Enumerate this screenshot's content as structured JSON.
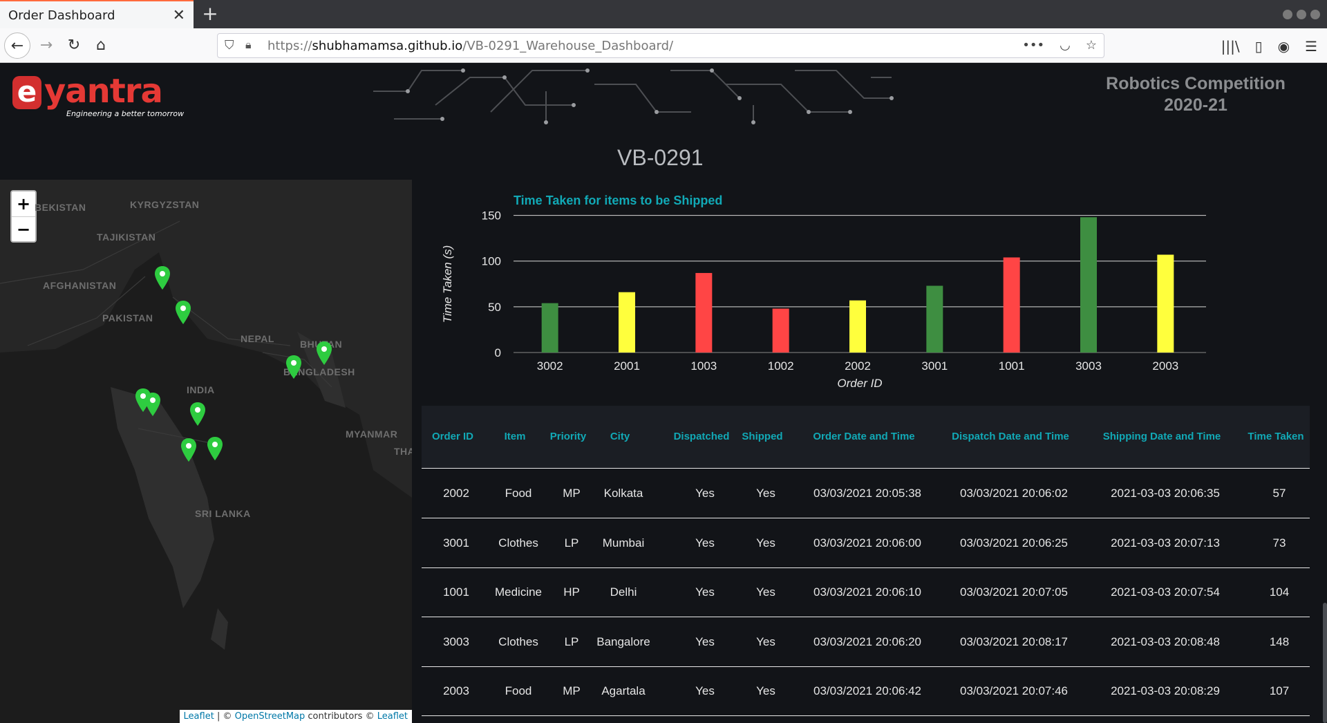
{
  "browser": {
    "tab_title": "Order Dashboard",
    "url_prefix": "https://",
    "url_domain": "shubhamamsa.github.io",
    "url_path": "/VB-0291_Warehouse_Dashboard/"
  },
  "header": {
    "logo_text": "yantra",
    "logo_letter": "e",
    "logo_tagline": "Engineering a better tomorrow",
    "competition_line1": "Robotics Competition",
    "competition_line2": "2020-21",
    "team_id": "VB-0291"
  },
  "map": {
    "zoom_in": "+",
    "zoom_out": "−",
    "labels": [
      "BEKISTAN",
      "KYRGYZSTAN",
      "TAJIKISTAN",
      "AFGHANISTAN",
      "PAKISTAN",
      "NEPAL",
      "BHUTAN",
      "BANGLADESH",
      "INDIA",
      "MYANMAR",
      "SRI LANKA",
      "THA"
    ],
    "marker_color": "#2ecc40",
    "attribution": {
      "leaflet": "Leaflet",
      "osm": "OpenStreetMap",
      "contributors": "contributors ©",
      "leaflet2": "Leaflet"
    }
  },
  "chart_data": {
    "type": "bar",
    "title": "Time Taken for items to be Shipped",
    "xlabel": "Order ID",
    "ylabel": "Time Taken (s)",
    "categories": [
      "3002",
      "2001",
      "1003",
      "1002",
      "2002",
      "3001",
      "1001",
      "3003",
      "2003"
    ],
    "values": [
      54,
      66,
      87,
      48,
      57,
      73,
      104,
      148,
      107
    ],
    "colors": [
      "#3e8e41",
      "#ffff3d",
      "#ff4545",
      "#ff4545",
      "#ffff3d",
      "#3e8e41",
      "#ff4545",
      "#3e8e41",
      "#ffff3d"
    ],
    "yticks": [
      0,
      50,
      100,
      150
    ],
    "ylim": [
      0,
      155
    ],
    "grid": true
  },
  "table": {
    "headers": [
      "Order ID",
      "Item",
      "Priority",
      "City",
      "Dispatched",
      "Shipped",
      "Order Date and Time",
      "Dispatch Date and Time",
      "Shipping Date and Time",
      "Time Taken"
    ],
    "rows": [
      [
        "2002",
        "Food",
        "MP",
        "Kolkata",
        "Yes",
        "Yes",
        "03/03/2021 20:05:38",
        "03/03/2021 20:06:02",
        "2021-03-03 20:06:35",
        "57"
      ],
      [
        "3001",
        "Clothes",
        "LP",
        "Mumbai",
        "Yes",
        "Yes",
        "03/03/2021 20:06:00",
        "03/03/2021 20:06:25",
        "2021-03-03 20:07:13",
        "73"
      ],
      [
        "1001",
        "Medicine",
        "HP",
        "Delhi",
        "Yes",
        "Yes",
        "03/03/2021 20:06:10",
        "03/03/2021 20:07:05",
        "2021-03-03 20:07:54",
        "104"
      ],
      [
        "3003",
        "Clothes",
        "LP",
        "Bangalore",
        "Yes",
        "Yes",
        "03/03/2021 20:06:20",
        "03/03/2021 20:08:17",
        "2021-03-03 20:08:48",
        "148"
      ],
      [
        "2003",
        "Food",
        "MP",
        "Agartala",
        "Yes",
        "Yes",
        "03/03/2021 20:06:42",
        "03/03/2021 20:07:46",
        "2021-03-03 20:08:29",
        "107"
      ]
    ]
  },
  "colors": {
    "accent": "#11a9b6",
    "background": "#121418",
    "high": "#ff4545",
    "medium": "#ffff3d",
    "low": "#3e8e41"
  }
}
